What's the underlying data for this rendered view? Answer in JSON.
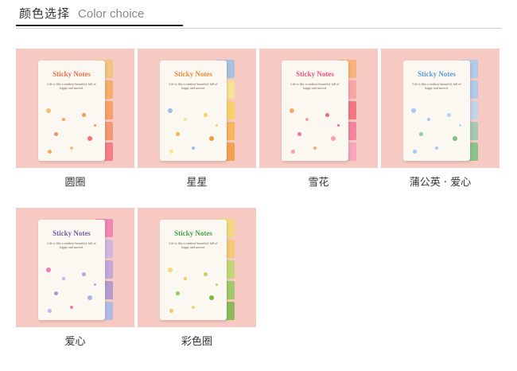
{
  "header": {
    "title_cn": "颜色选择",
    "title_en": "Color choice"
  },
  "sticky_label": "Sticky Notes",
  "sticky_sub": "Life is like a rainbow beautiful, full of happy and moved.",
  "items": [
    {
      "caption": "圆圈",
      "title_color": "#f07050",
      "tabs": [
        "#f2c27a",
        "#f5a85c",
        "#f49a58",
        "#f58e6a",
        "#f2707a"
      ]
    },
    {
      "caption": "星星",
      "title_color": "#ef8a3a",
      "tabs": [
        "#9cbfe8",
        "#f7e58a",
        "#f9d25a",
        "#f8b24a",
        "#f59a3e"
      ]
    },
    {
      "caption": "雪花",
      "title_color": "#e8557a",
      "tabs": [
        "#f4ae6c",
        "#f8a0a0",
        "#f26a7a",
        "#f2789a",
        "#f5a0b8"
      ]
    },
    {
      "caption": "蒲公英 · 爱心",
      "title_color": "#5a9ad8",
      "tabs": [
        "#a8c8f0",
        "#a8c8f0",
        "#b8d4f0",
        "#98c8b0",
        "#7cc080"
      ]
    },
    {
      "caption": "爱心",
      "title_color": "#7a5aa8",
      "tabs": [
        "#f07ab0",
        "#c8b4e8",
        "#b8a4dc",
        "#a894d0",
        "#a6b8ea"
      ]
    },
    {
      "caption": "彩色圈",
      "title_color": "#4aa04a",
      "tabs": [
        "#f2d874",
        "#f4c86a",
        "#b8d86a",
        "#92c85c",
        "#7ab84a"
      ]
    }
  ]
}
